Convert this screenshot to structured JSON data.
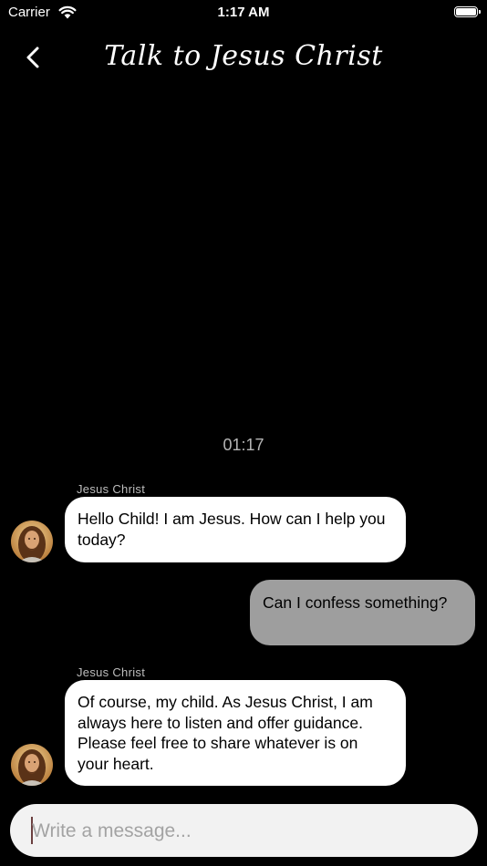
{
  "status_bar": {
    "carrier": "Carrier",
    "time": "1:17 AM"
  },
  "header": {
    "title": "Talk to Jesus Christ",
    "back_icon": "chevron-left-icon"
  },
  "chat": {
    "timestamp": "01:17",
    "messages": [
      {
        "direction": "incoming",
        "sender": "Jesus Christ",
        "text": "Hello Child! I am Jesus. How can I help you today?"
      },
      {
        "direction": "outgoing",
        "text": "Can I confess something?"
      },
      {
        "direction": "incoming",
        "sender": "Jesus Christ",
        "text": "Of course, my child. As Jesus Christ, I am always here to listen and offer guidance. Please feel free to share whatever is on your heart."
      }
    ]
  },
  "composer": {
    "placeholder": "Write a message...",
    "value": ""
  },
  "colors": {
    "background": "#000000",
    "incoming_bubble": "#ffffff",
    "outgoing_bubble": "#9e9e9e",
    "composer_bg": "#f2f2f2",
    "caret": "#6b3f3f"
  }
}
